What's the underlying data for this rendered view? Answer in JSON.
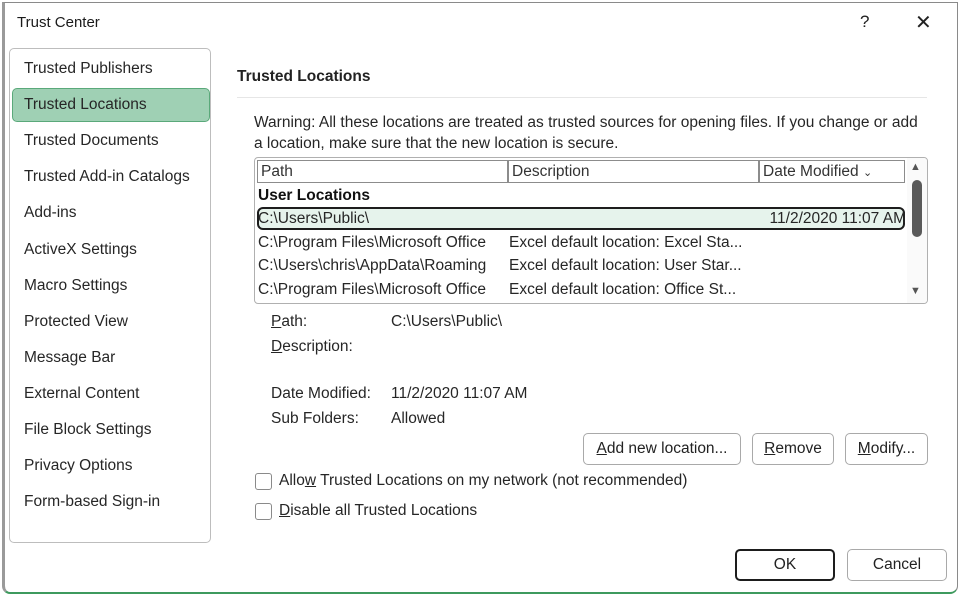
{
  "window": {
    "title": "Trust Center",
    "help_label": "?",
    "close_label": "✕"
  },
  "sidebar": {
    "items": [
      {
        "label": "Trusted Publishers",
        "selected": false
      },
      {
        "label": "Trusted Locations",
        "selected": true
      },
      {
        "label": "Trusted Documents",
        "selected": false
      },
      {
        "label": "Trusted Add-in Catalogs",
        "selected": false
      },
      {
        "label": "Add-ins",
        "selected": false
      },
      {
        "label": "ActiveX Settings",
        "selected": false
      },
      {
        "label": "Macro Settings",
        "selected": false
      },
      {
        "label": "Protected View",
        "selected": false
      },
      {
        "label": "Message Bar",
        "selected": false
      },
      {
        "label": "External Content",
        "selected": false
      },
      {
        "label": "File Block Settings",
        "selected": false
      },
      {
        "label": "Privacy Options",
        "selected": false
      },
      {
        "label": "Form-based Sign-in",
        "selected": false
      }
    ]
  },
  "main": {
    "section_title": "Trusted Locations",
    "warning": "Warning: All these locations are treated as trusted sources for opening files.  If you change or add a location, make sure that the new location is secure.",
    "list": {
      "columns": [
        "Path",
        "Description",
        "Date Modified"
      ],
      "sort_icon": "⌄",
      "group_label": "User Locations",
      "rows": [
        {
          "path": "C:\\Users\\Public\\",
          "description": "",
          "date": "11/2/2020 11:07 AM",
          "selected": true
        },
        {
          "path": "C:\\Program Files\\Microsoft Office",
          "description": "Excel default location: Excel Sta...",
          "date": "",
          "selected": false
        },
        {
          "path": "C:\\Users\\chris\\AppData\\Roaming",
          "description": "Excel default location: User Star...",
          "date": "",
          "selected": false
        },
        {
          "path": "C:\\Program Files\\Microsoft Office",
          "description": "Excel default location: Office St...",
          "date": "",
          "selected": false
        }
      ],
      "scroll_up": "▲",
      "scroll_down": "▼"
    },
    "details": {
      "path_label_key": "P",
      "path_label_rest": "ath:",
      "path_value": "C:\\Users\\Public\\",
      "desc_label_key": "D",
      "desc_label_rest": "escription:",
      "desc_value": "",
      "date_label": "Date Modified:",
      "date_value": "11/2/2020 11:07 AM",
      "sub_label": "Sub Folders:",
      "sub_value": "Allowed"
    },
    "buttons": {
      "add_key": "A",
      "add_rest": "dd new location...",
      "remove_key": "R",
      "remove_rest": "emove",
      "modify_key": "M",
      "modify_rest": "odify..."
    },
    "checkboxes": [
      {
        "pre": "Allo",
        "key": "w",
        "post": " Trusted Locations on my network (not recommended)",
        "checked": false
      },
      {
        "pre": "",
        "key": "D",
        "post": "isable all Trusted Locations",
        "checked": false
      }
    ]
  },
  "footer": {
    "ok_label": "OK",
    "cancel_label": "Cancel"
  }
}
